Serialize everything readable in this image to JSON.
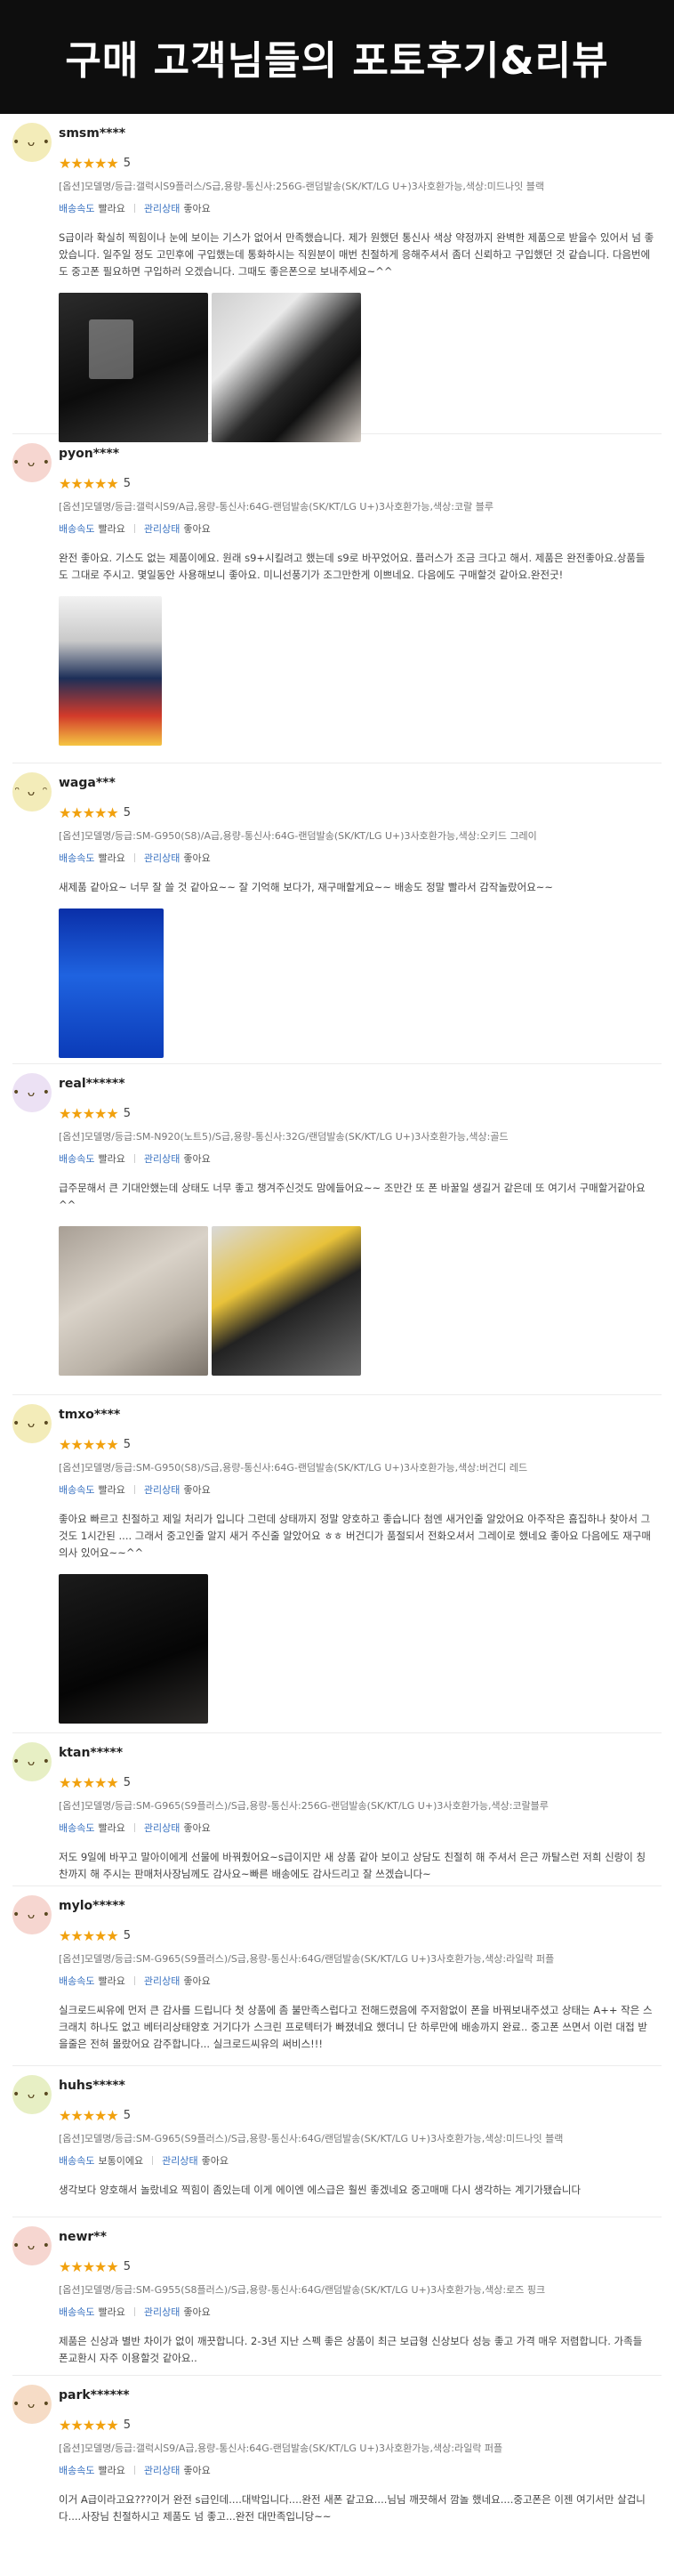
{
  "header": {
    "title": "구매 고객님들의 포토후기&리뷰"
  },
  "labels": {
    "shipping": "배송속도",
    "product_state": "관리상태",
    "stars": "★★★★★"
  },
  "colors": {
    "header_bg": "#0e0e0e",
    "star": "#f1a10e",
    "meta_key": "#3a73c2"
  },
  "reviews": [
    {
      "user": "smsm****",
      "score": "5",
      "option": "[옵션]모델명/등급:갤럭시S9플러스/S급,용량-통신사:256G-랜덤발송(SK/KT/LG U+)3사호환가능,색상:미드나잇 블랙",
      "shipping": "빨라요",
      "state": "좋아요",
      "content": "S급이라 확실히 찍힘이나 눈에 보이는 기스가 없어서 만족했습니다. 제가 원했던 통신사 색상 약정까지 완벽한 제품으로 받을수 있어서 넘 좋았습니다. 일주일 정도 고민후에 구입했는데 통화하시는 직원분이 매번 친절하게 응해주셔서 좀더 신뢰하고 구입했던 것 같습니다. 다음번에도 중고폰 필요하면 구입하러 오겠습니다. 그때도 좋은폰으로 보내주세요~^^"
    },
    {
      "user": "pyon****",
      "score": "5",
      "option": "[옵션]모델명/등급:갤럭시S9/A급,용량-통신사:64G-랜덤발송(SK/KT/LG U+)3사호환가능,색상:코랄 블루",
      "shipping": "빨라요",
      "state": "좋아요",
      "content": "완전 좋아요. 기스도 없는 제품이에요. 원래 s9+시킬려고 했는데 s9로 바꾸었어요. 플러스가 조금 크다고 해서. 제품은 완전좋아요.상품들도 그대로 주시고. 몇일동안 사용해보니 좋아요. 미니선풍기가 조그만한게 이쁘네요. 다음에도 구매할것 같아요.완전굿!"
    },
    {
      "user": "waga***",
      "score": "5",
      "option": "[옵션]모델명/등급:SM-G950(S8)/A급,용량-통신사:64G-랜덤발송(SK/KT/LG U+)3사호환가능,색상:오키드 그레이",
      "shipping": "빨라요",
      "state": "좋아요",
      "content": "새제품 같아요~ 너무 잘 쓸 것 같아요~~ 잘 기억해 보다가, 재구매할게요~~ 배송도 정말 빨라서 감작놀랐어요~~"
    },
    {
      "user": "real******",
      "score": "5",
      "option": "[옵션]모델명/등급:SM-N920(노트5)/S급,용량-통신사:32G/랜덤발송(SK/KT/LG U+)3사호환가능,색상:골드",
      "shipping": "빨라요",
      "state": "좋아요",
      "content": "급주문해서 큰 기대안했는데 상태도 너무 좋고 챙겨주신것도 맘에들어요~~ 조만간 또 폰 바꿀일 생길거 같은데 또 여기서 구매할거같아요^^"
    },
    {
      "user": "tmxo****",
      "score": "5",
      "option": "[옵션]모델명/등급:SM-G950(S8)/S급,용량-통신사:64G-랜덤발송(SK/KT/LG U+)3사호환가능,색상:버건디 레드",
      "shipping": "빨라요",
      "state": "좋아요",
      "content": "좋아요 빠르고 친절하고 제일 처리가 입니다 그런데 상태까지 정말 양호하고 좋습니다 첨엔 새거인줄 알았어요 아주작은 흠집하나 찾아서 그것도 1시간된 .... 그래서 중고인줄 알지 새거 주신줄 알았어요 ㅎㅎ 버건디가 품절되서 전화오셔서 그레이로 했네요 좋아요 다음에도 재구매 의사 있어요~~^^"
    },
    {
      "user": "ktan*****",
      "score": "5",
      "option": "[옵션]모델명/등급:SM-G965(S9플러스)/S급,용량-통신사:256G-랜덤발송(SK/KT/LG U+)3사호환가능,색상:코랄블루",
      "shipping": "빨라요",
      "state": "좋아요",
      "content": "저도 9일에 바꾸고 말아이에게 선물에 바꿔줬어요~s급이지만 새 상품 같아 보이고 상담도 친절히 해 주셔서 은근 까탈스런 저희 신랑이 칭찬까지 해 주시는 판매처사장님께도 감사요~빠른 배송에도 감사드리고 잘 쓰겠습니다~"
    },
    {
      "user": "mylo*****",
      "score": "5",
      "option": "[옵션]모델명/등급:SM-G965(S9플러스)/S급,용량-통신사:64G/랜덤발송(SK/KT/LG U+)3사호환가능,색상:라일락 퍼플",
      "shipping": "빨라요",
      "state": "좋아요",
      "content": "실크로드씨유에 먼저 큰 감사를 드립니다 첫 상품에 좀 불만족스럽다고 전해드렸음에 주저함없이 폰을 바꿔보내주셨고 상태는 A++ 작은 스크래치 하나도 없고 베터리상태양호 거기다가 스크린 프로텍터가 빠졌네요 했더니 단 하루만에 배송까지 완료.. 중고폰 쓰면서 이런 대접 받을줄은 전혀 몰랐어요 감주합니다... 실크로드씨유의 써비스!!!"
    },
    {
      "user": "huhs*****",
      "score": "5",
      "option": "[옵션]모델명/등급:SM-G965(S9플러스)/S급,용량-통신사:64G/랜덤발송(SK/KT/LG U+)3사호환가능,색상:미드나잇 블랙",
      "shipping": "보통이에요",
      "state": "좋아요",
      "content": "생각보다 양호해서 놀랐네요 찍힘이 좀있는데 이게 에이엔 에스급은 훨씬 좋겠네요 중고매매 다시 생각하는 계기가됐습니다"
    },
    {
      "user": "newr**",
      "score": "5",
      "option": "[옵션]모델명/등급:SM-G955(S8플러스)/S급,용량-통신사:64G/랜덤발송(SK/KT/LG U+)3사호환가능,색상:로즈 핑크",
      "shipping": "빨라요",
      "state": "좋아요",
      "content": "제품은 신상과 별반 차이가 없이 깨끗합니다. 2-3년 지난 스펙 좋은 상품이 최근 보급형 신상보다 성능 좋고 가격 매우 저렴합니다. 가족들 폰교환시 자주 이용할것 같아요.."
    },
    {
      "user": "park******",
      "score": "5",
      "option": "[옵션]모델명/등급:갤럭시S9/A급,용량-통신사:64G-랜덤발송(SK/KT/LG U+)3사호환가능,색상:라일락 퍼플",
      "shipping": "빨라요",
      "state": "좋아요",
      "content": "이거 A급이라고요???이거 완전 s급인데....대박입니다....완전 새폰 같고요....님님 깨끗해서 깜놀 했네요....중고폰은 이젠 여기서만 살겁니다....사장님 친절하시고 제품도 넘 좋고...완전 대만족입니당~~"
    }
  ]
}
